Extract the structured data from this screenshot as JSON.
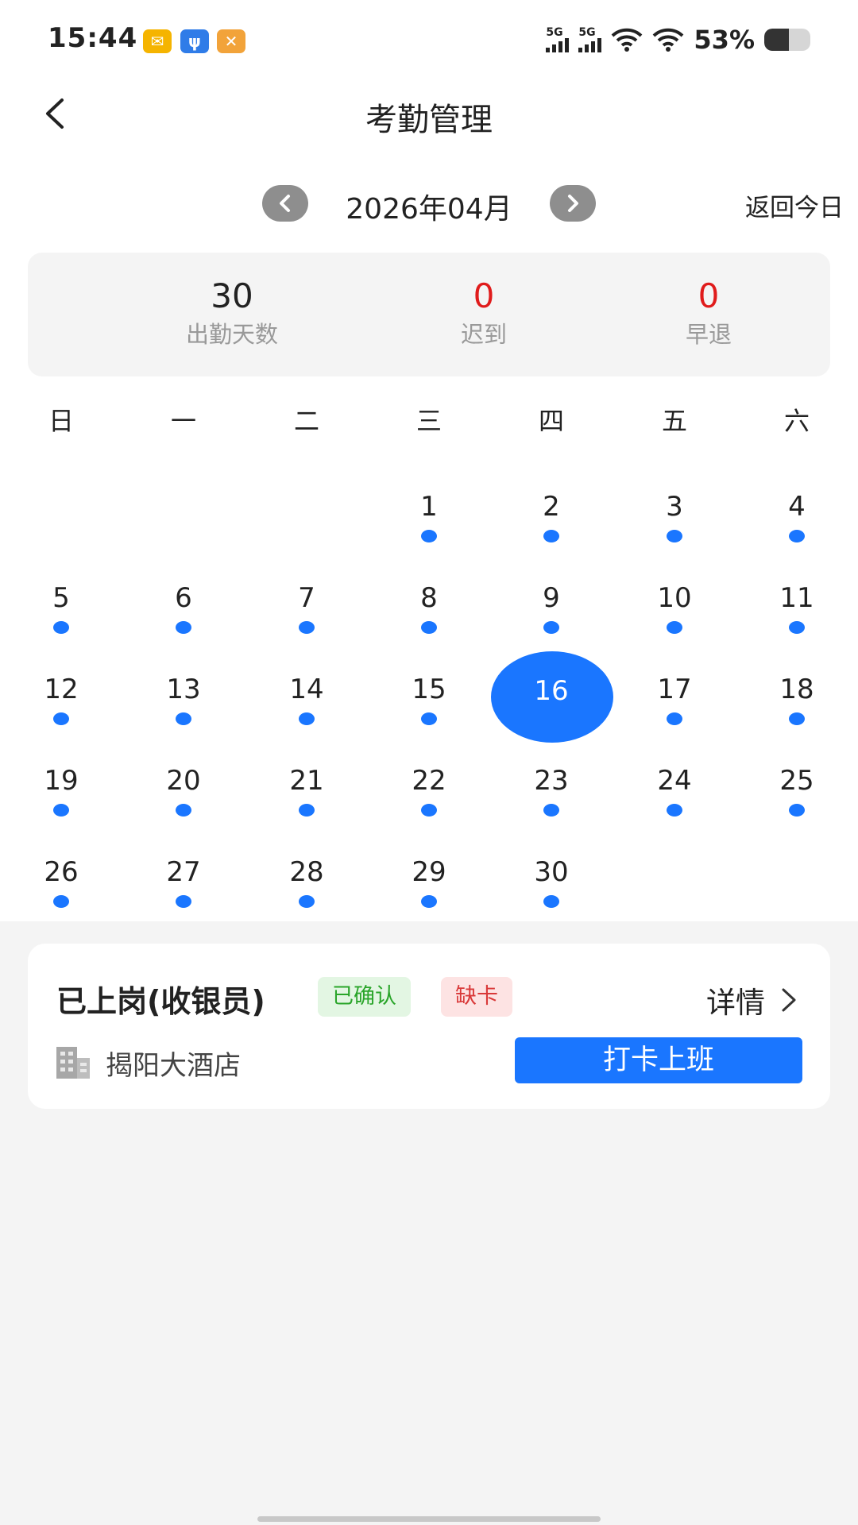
{
  "status_bar": {
    "time": "15:44",
    "signal1_label": "5G",
    "signal2_label": "5G",
    "battery_percent": "53%",
    "battery_level": 0.53,
    "icons": [
      "mail-icon",
      "usb-icon",
      "tools-icon",
      "wifi-icon",
      "battery-icon"
    ]
  },
  "header": {
    "title": "考勤管理"
  },
  "month_nav": {
    "label": "2026年04月",
    "today_label": "返回今日"
  },
  "stats": [
    {
      "value": "30",
      "label": "出勤天数"
    },
    {
      "value": "0",
      "label": "迟到"
    },
    {
      "value": "0",
      "label": "早退"
    }
  ],
  "colors": {
    "accent": "#1a76ff",
    "danger": "#e01b1b",
    "confirmed_text": "#2aa52a",
    "missing_text": "#d93939",
    "page_bg": "#f4f4f4"
  },
  "calendar": {
    "weekdays": [
      "日",
      "一",
      "二",
      "三",
      "四",
      "五",
      "六"
    ],
    "first_weekday_index": 3,
    "days_in_month": 30,
    "selected_day": 16,
    "days_with_attendance": [
      1,
      2,
      3,
      4,
      5,
      6,
      7,
      8,
      9,
      10,
      11,
      12,
      13,
      14,
      15,
      17,
      18,
      19,
      20,
      21,
      22,
      23,
      24,
      25,
      26,
      27,
      28,
      29,
      30
    ]
  },
  "shift": {
    "title": "已上岗(收银员)",
    "tag_confirmed": "已确认",
    "tag_missing": "缺卡",
    "detail_label": "详情",
    "store_name": "揭阳大酒店",
    "punch_button": "打卡上班"
  }
}
